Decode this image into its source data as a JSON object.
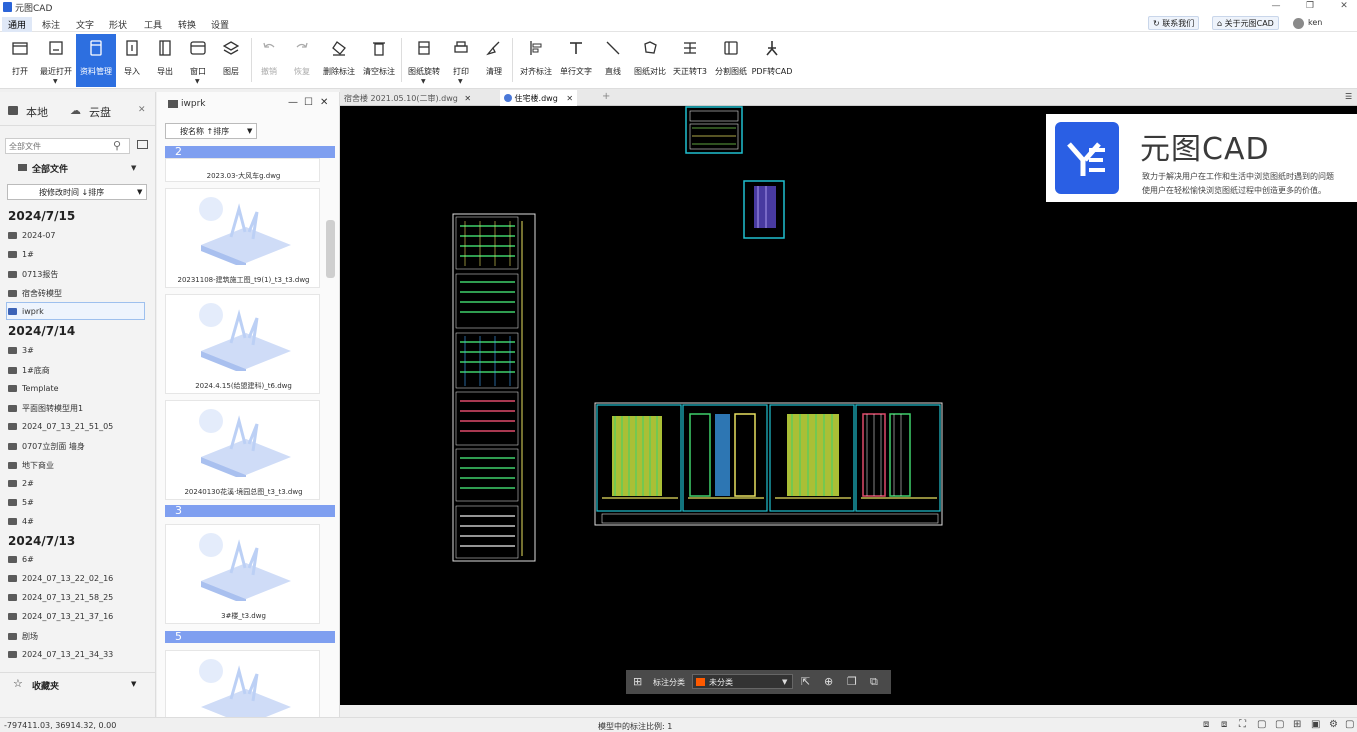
{
  "app": {
    "title": "元图CAD",
    "colors": {
      "accent": "#2d6fe0",
      "canvas": "#000000",
      "group_bar": "#7f9ff0"
    }
  },
  "menu": {
    "items": [
      "通用",
      "标注",
      "文字",
      "形状",
      "工具",
      "转换",
      "设置"
    ],
    "active": "通用",
    "right_buttons": [
      "联系我们",
      "关于元图CAD"
    ],
    "user": "ken"
  },
  "ribbon": {
    "tools": [
      {
        "label": "打开",
        "icon": "folder-open-icon"
      },
      {
        "label": "最近打开",
        "icon": "recent-icon"
      },
      {
        "label": "资料管理",
        "icon": "library-icon",
        "active": true
      },
      {
        "label": "导入",
        "icon": "import-icon"
      },
      {
        "label": "导出",
        "icon": "export-icon"
      },
      {
        "label": "窗口",
        "icon": "window-icon"
      },
      {
        "label": "图层",
        "icon": "layers-icon"
      },
      {
        "label": "撤销",
        "icon": "undo-icon",
        "disabled": true
      },
      {
        "label": "恢复",
        "icon": "redo-icon",
        "disabled": true
      },
      {
        "label": "删除标注",
        "icon": "eraser-icon"
      },
      {
        "label": "清空标注",
        "icon": "trash-icon"
      },
      {
        "label": "图纸旋转",
        "icon": "rotate-icon"
      },
      {
        "label": "打印",
        "icon": "print-icon"
      },
      {
        "label": "清理",
        "icon": "broom-icon"
      },
      {
        "label": "对齐标注",
        "icon": "align-icon"
      },
      {
        "label": "单行文字",
        "icon": "text-icon"
      },
      {
        "label": "直线",
        "icon": "line-icon"
      },
      {
        "label": "图纸对比",
        "icon": "compare-icon"
      },
      {
        "label": "天正转T3",
        "icon": "convert-t3-icon"
      },
      {
        "label": "分割图纸",
        "icon": "split-icon"
      },
      {
        "label": "PDF转CAD",
        "icon": "pdf-icon"
      }
    ]
  },
  "left_panel": {
    "tabs": [
      "本地",
      "云盘"
    ],
    "search_placeholder": "全部文件",
    "all_files": "全部文件",
    "sort_label": "按修改时间 ↓排序",
    "groups": [
      {
        "date": "2024/7/15",
        "items": [
          "2024-07",
          "1#",
          "0713报告",
          "宿舍砖模型",
          "iwprk"
        ]
      },
      {
        "date": "2024/7/14",
        "items": [
          "3#",
          "1#底商",
          "Template",
          "平面图转模型用1",
          "2024_07_13_21_51_05",
          "0707立剖面 墙身",
          "地下商业",
          "2#",
          "5#",
          "4#"
        ]
      },
      {
        "date": "2024/7/13",
        "items": [
          "6#",
          "2024_07_13_22_02_16",
          "2024_07_13_21_58_25",
          "2024_07_13_21_37_16",
          "剧场",
          "2024_07_13_21_34_33"
        ]
      }
    ],
    "selected": "iwprk",
    "favorites": "收藏夹"
  },
  "file_panel": {
    "folder": "iwprk",
    "sort_label": "按名称 ↑排序",
    "groups": [
      "2",
      "3",
      "5"
    ],
    "files": [
      "2023.03-大风车g.dwg",
      "20231108-建筑施工图_t9(1)_t3_t3.dwg",
      "2024.4.15(给盟建科)_t6.dwg",
      "20240130花溪·境园总图_t3_t3.dwg",
      "3#楼_t3.dwg"
    ]
  },
  "doc_tabs": [
    {
      "label": "宿舍楼 2021.05.10(二审).dwg",
      "active": false
    },
    {
      "label": "住宅楼.dwg",
      "active": true
    }
  ],
  "promo": {
    "brand": "元图CAD",
    "line1": "致力于解决用户在工作和生活中浏览图纸时遇到的问题",
    "line2": "使用户在轻松愉快浏览图纸过程中创造更多的价值。"
  },
  "anno_bar": {
    "label": "标注分类",
    "category": "未分类",
    "category_color": "#ff5a00"
  },
  "status": {
    "coords": "-797411.03, 36914.32, 0.00",
    "scale_text": "模型中的标注比例: 1"
  }
}
